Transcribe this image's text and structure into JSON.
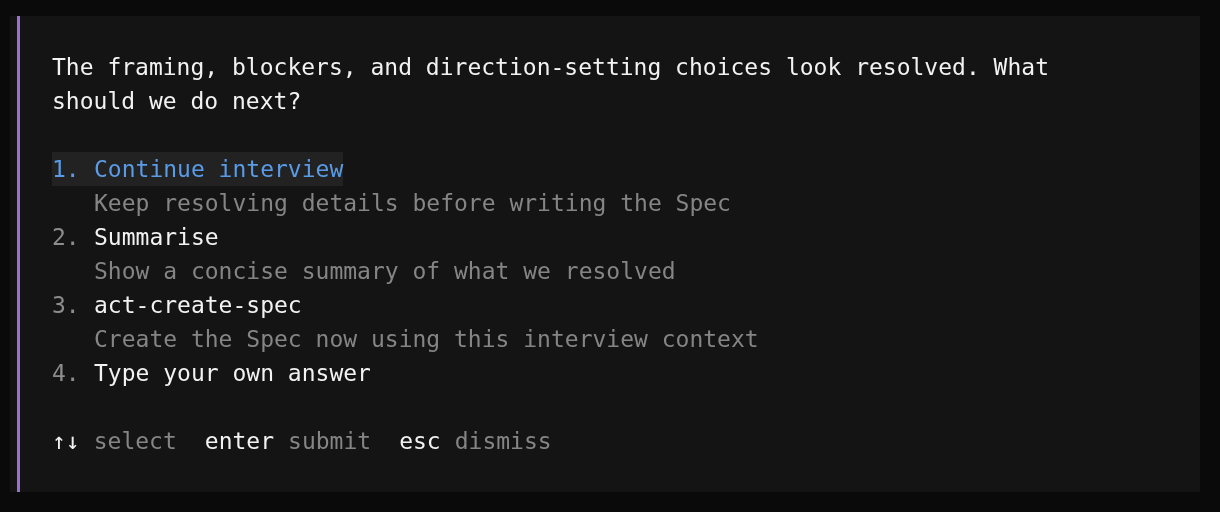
{
  "prompt": "The framing, blockers, and direction-setting choices look resolved. What should we do next?",
  "options": [
    {
      "number": "1.",
      "label": "Continue interview",
      "description": "Keep resolving details before writing the Spec",
      "selected": true
    },
    {
      "number": "2.",
      "label": "Summarise",
      "description": "Show a concise summary of what we resolved",
      "selected": false
    },
    {
      "number": "3.",
      "label": "act-create-spec",
      "description": "Create the Spec now using this interview context",
      "selected": false
    },
    {
      "number": "4.",
      "label": "Type your own answer",
      "selected": false
    }
  ],
  "hints": [
    {
      "key": "↑↓",
      "action": "select"
    },
    {
      "key": "enter",
      "action": "submit"
    },
    {
      "key": "esc",
      "action": "dismiss"
    }
  ]
}
